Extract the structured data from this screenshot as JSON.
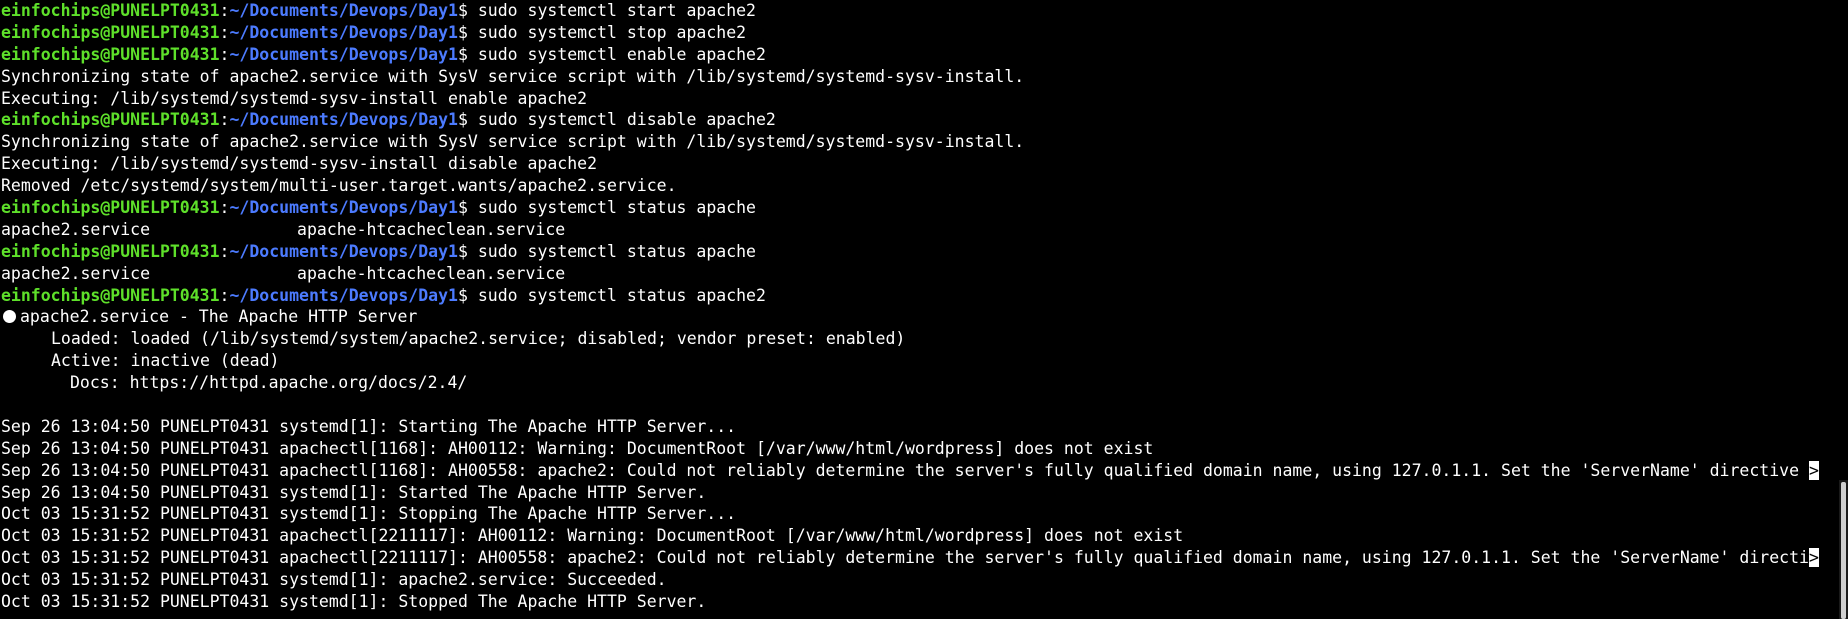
{
  "prompt": {
    "user_host": "einfochips@PUNELPT0431",
    "colon": ":",
    "path": "~/Documents/Devops/Day1",
    "dollar": "$ "
  },
  "lines": {
    "l1_cmd": "sudo systemctl start apache2",
    "l2_cmd": "sudo systemctl stop apache2",
    "l3_cmd": "sudo systemctl enable apache2",
    "l4": "Synchronizing state of apache2.service with SysV service script with /lib/systemd/systemd-sysv-install.",
    "l5": "Executing: /lib/systemd/systemd-sysv-install enable apache2",
    "l6_cmd": "sudo systemctl disable apache2",
    "l7": "Synchronizing state of apache2.service with SysV service script with /lib/systemd/systemd-sysv-install.",
    "l8": "Executing: /lib/systemd/systemd-sysv-install disable apache2",
    "l9": "Removed /etc/systemd/system/multi-user.target.wants/apache2.service.",
    "l10_cmd": "sudo systemctl status apache",
    "l11_a": "apache2.service",
    "l11_b": "apache-htcacheclean.service",
    "l12_cmd": "sudo systemctl status apache",
    "l13_a": "apache2.service",
    "l13_b": "apache-htcacheclean.service",
    "l14_cmd": "sudo systemctl status apache2",
    "l15": "apache2.service - The Apache HTTP Server",
    "l16": "Loaded: loaded (/lib/systemd/system/apache2.service; disabled; vendor preset: enabled)",
    "l17": "Active: inactive (dead)",
    "l18": "Docs: https://httpd.apache.org/docs/2.4/",
    "l20": "Sep 26 13:04:50 PUNELPT0431 systemd[1]: Starting The Apache HTTP Server...",
    "l21": "Sep 26 13:04:50 PUNELPT0431 apachectl[1168]: AH00112: Warning: DocumentRoot [/var/www/html/wordpress] does not exist",
    "l22": "Sep 26 13:04:50 PUNELPT0431 apachectl[1168]: AH00558: apache2: Could not reliably determine the server's fully qualified domain name, using 127.0.1.1. Set the 'ServerName' directive ",
    "l22_rev": ">",
    "l23": "Sep 26 13:04:50 PUNELPT0431 systemd[1]: Started The Apache HTTP Server.",
    "l24": "Oct 03 15:31:52 PUNELPT0431 systemd[1]: Stopping The Apache HTTP Server...",
    "l25": "Oct 03 15:31:52 PUNELPT0431 apachectl[2211117]: AH00112: Warning: DocumentRoot [/var/www/html/wordpress] does not exist",
    "l26": "Oct 03 15:31:52 PUNELPT0431 apachectl[2211117]: AH00558: apache2: Could not reliably determine the server's fully qualified domain name, using 127.0.1.1. Set the 'ServerName' directi",
    "l26_rev": ">",
    "l27": "Oct 03 15:31:52 PUNELPT0431 systemd[1]: apache2.service: Succeeded.",
    "l28": "Oct 03 15:31:52 PUNELPT0431 systemd[1]: Stopped The Apache HTTP Server."
  },
  "colors": {
    "background": "#000000",
    "text": "#ffffff",
    "user_host": "#5ee02a",
    "path": "#4c7bff"
  },
  "icons": {
    "status_dot": "circle-icon"
  }
}
